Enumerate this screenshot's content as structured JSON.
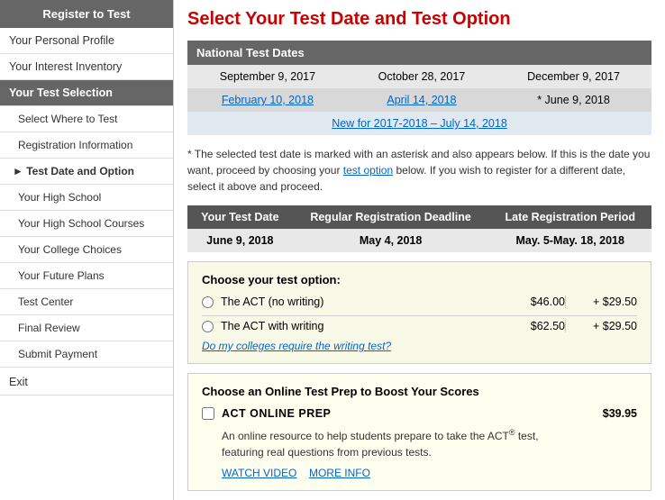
{
  "sidebar": {
    "header": "Register to Test",
    "items": [
      {
        "id": "personal-profile",
        "label": "Your Personal Profile",
        "type": "normal"
      },
      {
        "id": "interest-inventory",
        "label": "Your Interest Inventory",
        "type": "normal"
      },
      {
        "id": "test-selection",
        "label": "Your Test Selection",
        "type": "active"
      },
      {
        "id": "select-where",
        "label": "Select Where to Test",
        "type": "sub"
      },
      {
        "id": "registration-info",
        "label": "Registration Information",
        "type": "sub"
      },
      {
        "id": "test-date-option",
        "label": "Test Date and Option",
        "type": "arrow-active"
      },
      {
        "id": "high-school",
        "label": "Your High School",
        "type": "sub"
      },
      {
        "id": "high-school-courses",
        "label": "Your High School Courses",
        "type": "sub"
      },
      {
        "id": "college-choices",
        "label": "Your College Choices",
        "type": "sub"
      },
      {
        "id": "future-plans",
        "label": "Your Future Plans",
        "type": "sub"
      },
      {
        "id": "test-center",
        "label": "Test Center",
        "type": "sub"
      },
      {
        "id": "final-review",
        "label": "Final Review",
        "type": "sub"
      },
      {
        "id": "submit-payment",
        "label": "Submit Payment",
        "type": "sub"
      },
      {
        "id": "exit",
        "label": "Exit",
        "type": "exit"
      }
    ]
  },
  "main": {
    "title": "Select Your Test Date and Test Option",
    "national_dates_header": "National Test Dates",
    "dates_row1": [
      "September 9, 2017",
      "October 28, 2017",
      "December 9, 2017"
    ],
    "dates_row2": [
      "February 10, 2018",
      "April 14, 2018",
      "* June 9, 2018"
    ],
    "new_row_label": "New for 2017-2018 – July 14, 2018",
    "info_text_part1": "* The selected test date is marked with an asterisk and also appears below. If this is the date you want, proceed by choosing your ",
    "info_text_link": "test option",
    "info_text_part2": " below. If you wish to register for a different date, select it above and proceed.",
    "selected_date_headers": [
      "Your Test Date",
      "Regular Registration Deadline",
      "Late Registration Period"
    ],
    "selected_date_row": [
      "June 9, 2018",
      "May 4, 2018",
      "May. 5-May. 18, 2018"
    ],
    "choose_option_title": "Choose your test option:",
    "option1_label": "The ACT (no writing)",
    "option1_price": "$46.00",
    "option1_extra": "+ $29.50",
    "option2_label": "The ACT with writing",
    "option2_price": "$62.50",
    "option2_extra": "+ $29.50",
    "do_colleges_link": "Do my colleges require the writing test?",
    "prep_title": "Choose an Online Test Prep to Boost Your Scores",
    "prep_item_label": "ACT ONLINE PREP",
    "prep_item_price": "$39.95",
    "prep_desc1": "An online resource to help students prepare to take the ACT",
    "prep_desc_reg": "®",
    "prep_desc2": " test,",
    "prep_desc3": "featuring real questions from previous tests.",
    "prep_watch_link": "WATCH VIDEO",
    "prep_more_link": "MORE INFO"
  }
}
